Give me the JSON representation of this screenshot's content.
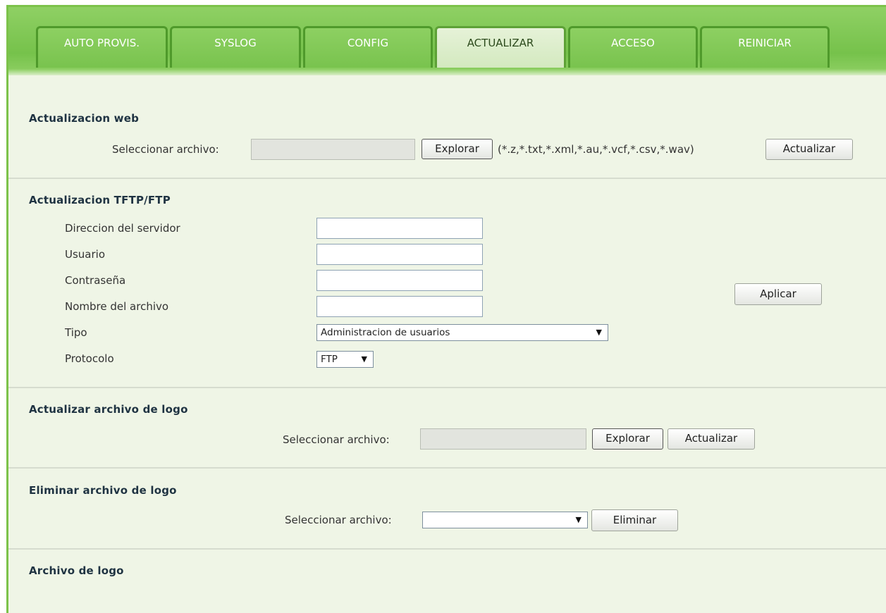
{
  "tabs": [
    {
      "label": "AUTO PROVIS.",
      "active": false
    },
    {
      "label": "SYSLOG",
      "active": false
    },
    {
      "label": "CONFIG",
      "active": false
    },
    {
      "label": "ACTUALIZAR",
      "active": true
    },
    {
      "label": "ACCESO",
      "active": false
    },
    {
      "label": "REINICIAR",
      "active": false
    }
  ],
  "web_update": {
    "title": "Actualizacion web",
    "select_label": "Seleccionar archivo:",
    "file_value": "",
    "browse_label": "Explorar",
    "extensions": "(*.z,*.txt,*.xml,*.au,*.vcf,*.csv,*.wav)",
    "update_label": "Actualizar"
  },
  "tftp": {
    "title": "Actualizacion TFTP/FTP",
    "server_label": "Direccion del servidor",
    "server_value": "",
    "user_label": "Usuario",
    "user_value": "",
    "password_label": "Contraseña",
    "password_value": "",
    "filename_label": "Nombre del archivo",
    "filename_value": "",
    "type_label": "Tipo",
    "type_value": "Administracion de usuarios",
    "protocol_label": "Protocolo",
    "protocol_value": "FTP",
    "apply_label": "Aplicar"
  },
  "logo_update": {
    "title": "Actualizar archivo de logo",
    "select_label": "Seleccionar archivo:",
    "file_value": "",
    "browse_label": "Explorar",
    "update_label": "Actualizar"
  },
  "logo_delete": {
    "title": "Eliminar archivo de logo",
    "select_label": "Seleccionar archivo:",
    "select_value": "",
    "delete_label": "Eliminar"
  },
  "logo_file": {
    "title": "Archivo de logo"
  },
  "colors": {
    "tab_green": "#7cc24a",
    "tab_border": "#4f9a2b",
    "content_bg": "#eff5e6",
    "heading": "#1f3342"
  }
}
